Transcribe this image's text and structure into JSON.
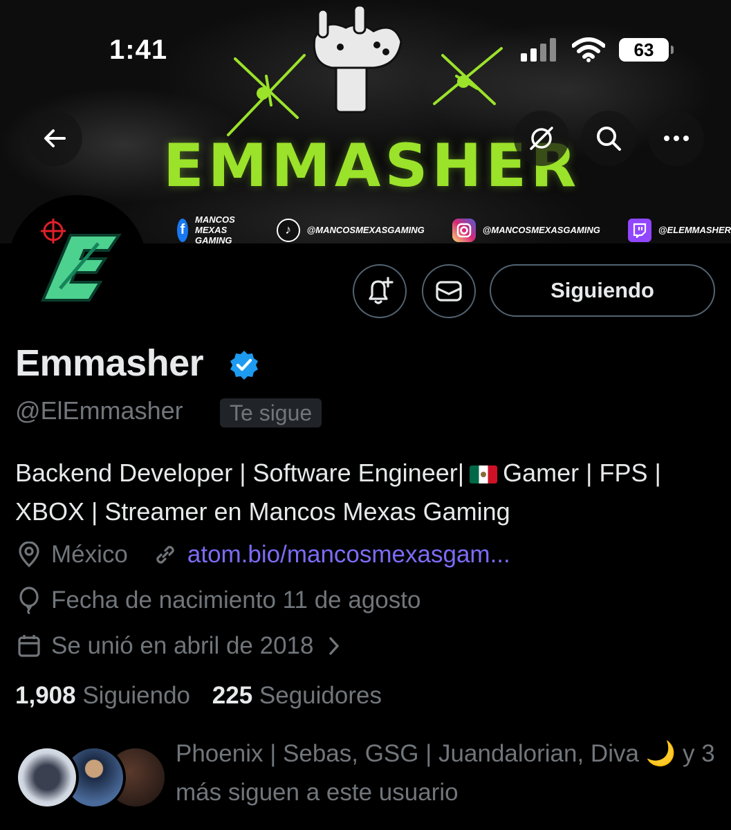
{
  "status_bar": {
    "time": "1:41",
    "battery": "63"
  },
  "banner": {
    "title": "EMMASHER",
    "socials": [
      {
        "platform": "facebook",
        "handle": "MANCOS MEXAS GAMING",
        "color": "#1877f2"
      },
      {
        "platform": "tiktok",
        "handle": "@MANCOSMEXASGAMING",
        "color": "#111111"
      },
      {
        "platform": "instagram",
        "handle": "@MANCOSMEXASGAMING",
        "color": "#d62976"
      },
      {
        "platform": "twitch",
        "handle": "@ELEMMASHER",
        "color": "#9146ff"
      }
    ],
    "accent_color": "#9be22a"
  },
  "nav": {
    "back_icon": "arrow-left-icon",
    "grok_icon": "grok-icon",
    "search_icon": "search-icon",
    "more_icon": "more-horizontal-icon"
  },
  "actions": {
    "notify_icon": "bell-plus-icon",
    "message_icon": "envelope-icon",
    "follow_label": "Siguiendo"
  },
  "profile": {
    "display_name": "Emmasher",
    "verified": true,
    "handle": "@ElEmmasher",
    "follows_you": "Te sigue",
    "bio_part1": "Backend Developer | Software Engineer|",
    "bio_part2": "Gamer | FPS | XBOX | Streamer en Mancos Mexas Gaming",
    "location": "México",
    "website": "atom.bio/mancosmexasgam...",
    "birthday": "Fecha de nacimiento 11 de agosto",
    "joined": "Se unió en abril de 2018"
  },
  "stats": {
    "following_count": "1,908",
    "following_label": "Siguiendo",
    "followers_count": "225",
    "followers_label": "Seguidores"
  },
  "mutuals": {
    "text": "Phoenix | Sebas, GSG | Juandalorian, Diva 🌙 y 3 más siguen a este usuario"
  },
  "colors": {
    "background": "#000000",
    "text_primary": "#e7e9ea",
    "text_secondary": "#71767b",
    "link": "#7b6cf6",
    "verified": "#1d9bf0",
    "border": "#536471"
  }
}
